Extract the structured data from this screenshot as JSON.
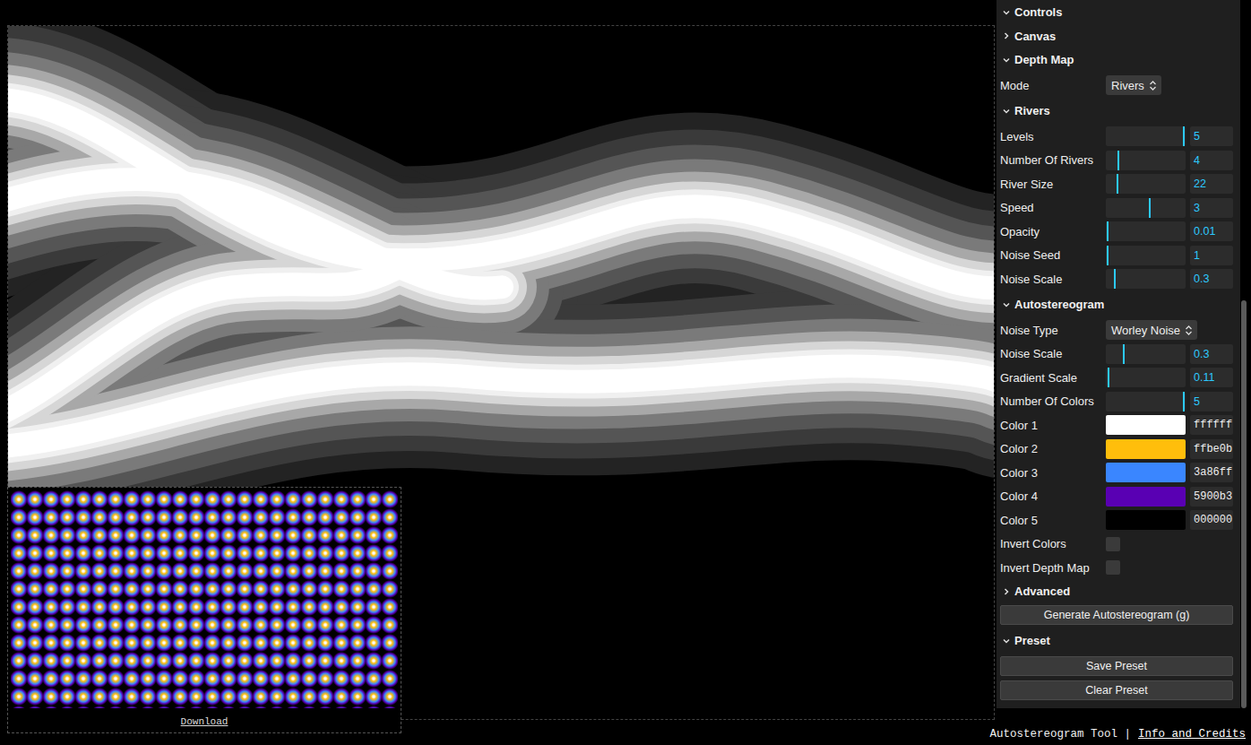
{
  "panel": {
    "title": "Controls",
    "expanded": true,
    "folders": [
      {
        "title": "Canvas",
        "expanded": false,
        "items": []
      },
      {
        "title": "Depth Map",
        "expanded": true,
        "items": [
          {
            "kind": "select",
            "label": "Mode",
            "value": "Rivers"
          }
        ]
      },
      {
        "title": "Rivers",
        "expanded": true,
        "items": [
          {
            "kind": "slider",
            "label": "Levels",
            "value": "5",
            "level": 0.99
          },
          {
            "kind": "slider",
            "label": "Number Of Rivers",
            "value": "4",
            "level": 0.15
          },
          {
            "kind": "slider",
            "label": "River Size",
            "value": "22",
            "level": 0.14
          },
          {
            "kind": "slider",
            "label": "Speed",
            "value": "3",
            "level": 0.55
          },
          {
            "kind": "slider",
            "label": "Opacity",
            "value": "0.01",
            "level": 0.01
          },
          {
            "kind": "slider",
            "label": "Noise Seed",
            "value": "1",
            "level": 0.01
          },
          {
            "kind": "slider",
            "label": "Noise Scale",
            "value": "0.3",
            "level": 0.1
          }
        ]
      },
      {
        "title": "Autostereogram",
        "expanded": true,
        "items": [
          {
            "kind": "select",
            "label": "Noise Type",
            "value": "Worley Noise"
          },
          {
            "kind": "slider",
            "label": "Noise Scale",
            "value": "0.3",
            "level": 0.22
          },
          {
            "kind": "slider",
            "label": "Gradient Scale",
            "value": "0.11",
            "level": 0.02
          },
          {
            "kind": "slider",
            "label": "Number Of Colors",
            "value": "5",
            "level": 0.99
          },
          {
            "kind": "color",
            "label": "Color 1",
            "value": "ffffff",
            "color": "#ffffff"
          },
          {
            "kind": "color",
            "label": "Color 2",
            "value": "ffbe0b",
            "color": "#ffbe0b"
          },
          {
            "kind": "color",
            "label": "Color 3",
            "value": "3a86ff",
            "color": "#3a86ff"
          },
          {
            "kind": "color",
            "label": "Color 4",
            "value": "5900b3",
            "color": "#5900b3"
          },
          {
            "kind": "color",
            "label": "Color 5",
            "value": "000000",
            "color": "#000000"
          },
          {
            "kind": "checkbox",
            "label": "Invert Colors",
            "checked": false
          },
          {
            "kind": "checkbox",
            "label": "Invert Depth Map",
            "checked": false
          },
          {
            "kind": "folder",
            "label": "Advanced",
            "expanded": false
          },
          {
            "kind": "button",
            "label": "Generate Autostereogram (g)"
          }
        ]
      },
      {
        "title": "Preset",
        "expanded": true,
        "items": [
          {
            "kind": "button",
            "label": "Save Preset"
          },
          {
            "kind": "button",
            "label": "Clear Preset"
          }
        ]
      }
    ]
  },
  "preview": {
    "link": "Download"
  },
  "footer": {
    "text": "Autostereogram Tool |",
    "link": "Info and Credits"
  }
}
